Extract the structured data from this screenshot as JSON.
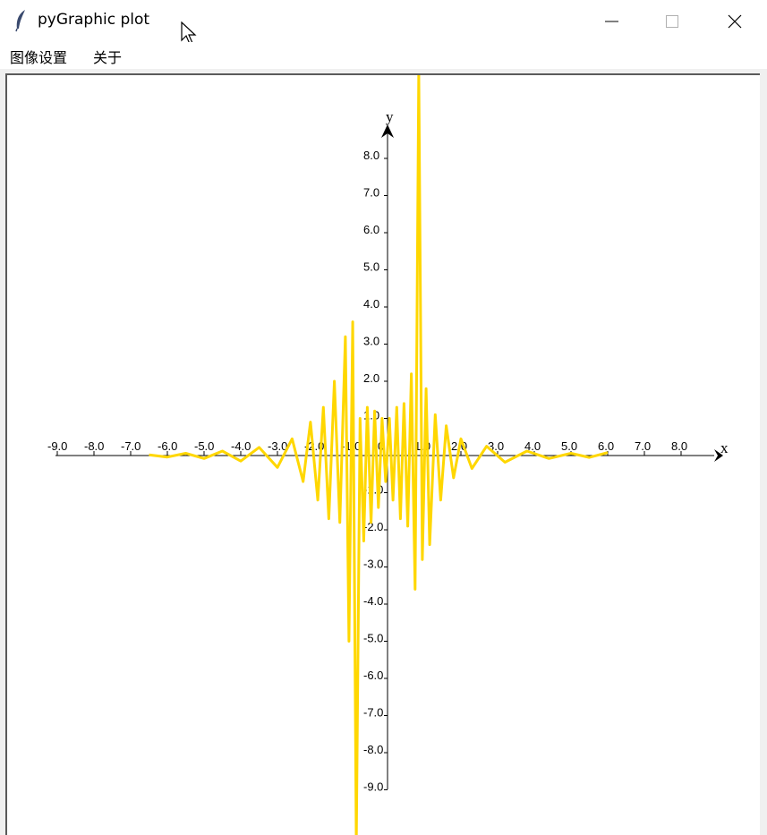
{
  "window": {
    "title": "pyGraphic plot",
    "controls": [
      "minimize",
      "maximize",
      "close"
    ]
  },
  "menu": {
    "items": [
      {
        "label": "图像设置"
      },
      {
        "label": "关于"
      }
    ]
  },
  "chart_data": {
    "type": "line",
    "x_axis_name": "x",
    "y_axis_name": "y",
    "x_ticks": [
      "-9.0",
      "-8.0",
      "-7.0",
      "-6.0",
      "-5.0",
      "-4.0",
      "-3.0",
      "-2.0",
      "-1.0",
      "0",
      "1.0",
      "2.0",
      "3.0",
      "4.0",
      "5.0",
      "6.0",
      "7.0",
      "8.0"
    ],
    "y_ticks": [
      "8.0",
      "7.0",
      "6.0",
      "5.0",
      "4.0",
      "3.0",
      "2.0",
      "1.0",
      "-1.0",
      "-2.0",
      "-3.0",
      "-4.0",
      "-5.0",
      "-6.0",
      "-7.0",
      "-8.0",
      "-9.0"
    ],
    "xlim": [
      -9.5,
      9.0
    ],
    "ylim": [
      -10.0,
      10.3
    ],
    "x_range": [
      -6.5,
      6.0
    ],
    "grid": false,
    "series": [
      {
        "color": "#FFD700",
        "description": "rapidly oscillating function, amplitude growing toward x=0; spikes near x≈-1 and x≈1 exceed the visible range",
        "points": [
          [
            -6.5,
            0.02
          ],
          [
            -6.0,
            -0.04
          ],
          [
            -5.5,
            0.06
          ],
          [
            -5.0,
            -0.08
          ],
          [
            -4.5,
            0.12
          ],
          [
            -4.0,
            -0.15
          ],
          [
            -3.5,
            0.22
          ],
          [
            -3.0,
            -0.32
          ],
          [
            -2.6,
            0.45
          ],
          [
            -2.3,
            -0.7
          ],
          [
            -2.1,
            0.9
          ],
          [
            -1.9,
            -1.2
          ],
          [
            -1.75,
            1.3
          ],
          [
            -1.6,
            -1.7
          ],
          [
            -1.45,
            2.0
          ],
          [
            -1.3,
            -1.8
          ],
          [
            -1.15,
            3.2
          ],
          [
            -1.05,
            -5.0
          ],
          [
            -0.95,
            3.6
          ],
          [
            -0.85,
            -10.0
          ],
          [
            -0.75,
            1.0
          ],
          [
            -0.65,
            -2.3
          ],
          [
            -0.55,
            1.3
          ],
          [
            -0.45,
            -1.8
          ],
          [
            -0.35,
            1.2
          ],
          [
            -0.25,
            -1.4
          ],
          [
            -0.15,
            1.0
          ],
          [
            -0.05,
            -0.7
          ],
          [
            0.05,
            1.0
          ],
          [
            0.15,
            -1.2
          ],
          [
            0.25,
            1.3
          ],
          [
            0.35,
            -1.7
          ],
          [
            0.45,
            1.4
          ],
          [
            0.55,
            -1.9
          ],
          [
            0.65,
            2.2
          ],
          [
            0.75,
            -3.6
          ],
          [
            0.85,
            10.3
          ],
          [
            0.95,
            -2.8
          ],
          [
            1.05,
            1.8
          ],
          [
            1.15,
            -2.4
          ],
          [
            1.3,
            1.1
          ],
          [
            1.45,
            -1.2
          ],
          [
            1.6,
            0.8
          ],
          [
            1.8,
            -0.6
          ],
          [
            2.0,
            0.45
          ],
          [
            2.3,
            -0.35
          ],
          [
            2.7,
            0.25
          ],
          [
            3.2,
            -0.18
          ],
          [
            3.8,
            0.12
          ],
          [
            4.4,
            -0.08
          ],
          [
            5.0,
            0.06
          ],
          [
            5.5,
            -0.05
          ],
          [
            6.0,
            0.08
          ]
        ]
      }
    ]
  }
}
